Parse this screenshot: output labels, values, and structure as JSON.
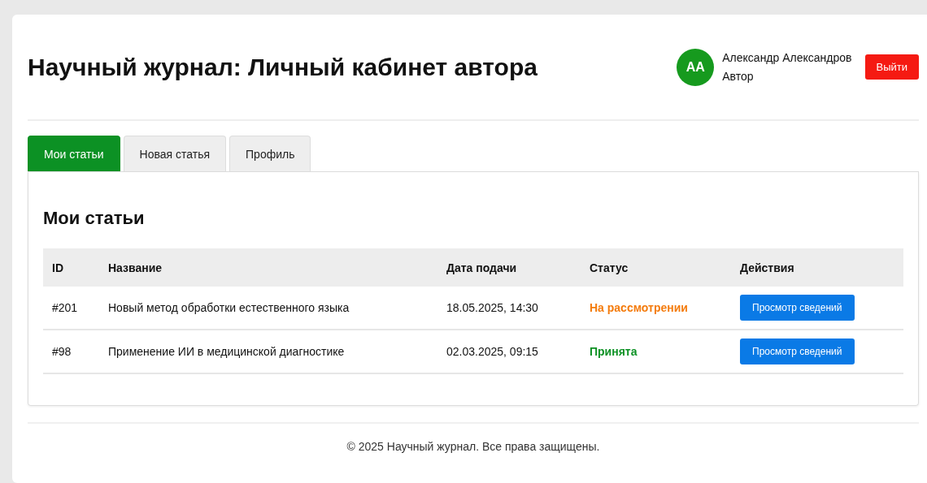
{
  "header": {
    "title": "Научный журнал: Личный кабинет автора",
    "user": {
      "initials": "АА",
      "name": "Александр Александров",
      "role": "Автор"
    },
    "logout": "Выйти"
  },
  "tabs": [
    {
      "label": "Мои статьи",
      "selected": true
    },
    {
      "label": "Новая статья",
      "selected": false
    },
    {
      "label": "Профиль",
      "selected": false
    }
  ],
  "panel": {
    "heading": "Мои статьи",
    "table": {
      "columns": [
        "ID",
        "Название",
        "Дата подачи",
        "Статус",
        "Действия"
      ],
      "rows": [
        {
          "id": "#201",
          "title": "Новый метод обработки естественного языка",
          "date": "18.05.2025, 14:30",
          "status": {
            "text": "На рассмотрении",
            "kind": "review"
          },
          "action": "Просмотр сведений"
        },
        {
          "id": "#98",
          "title": "Применение ИИ в медицинской диагностике",
          "date": "02.03.2025, 09:15",
          "status": {
            "text": "Принята",
            "kind": "accepted"
          },
          "action": "Просмотр сведений"
        }
      ]
    }
  },
  "footer": "© 2025 Научный журнал. Все права защищены."
}
